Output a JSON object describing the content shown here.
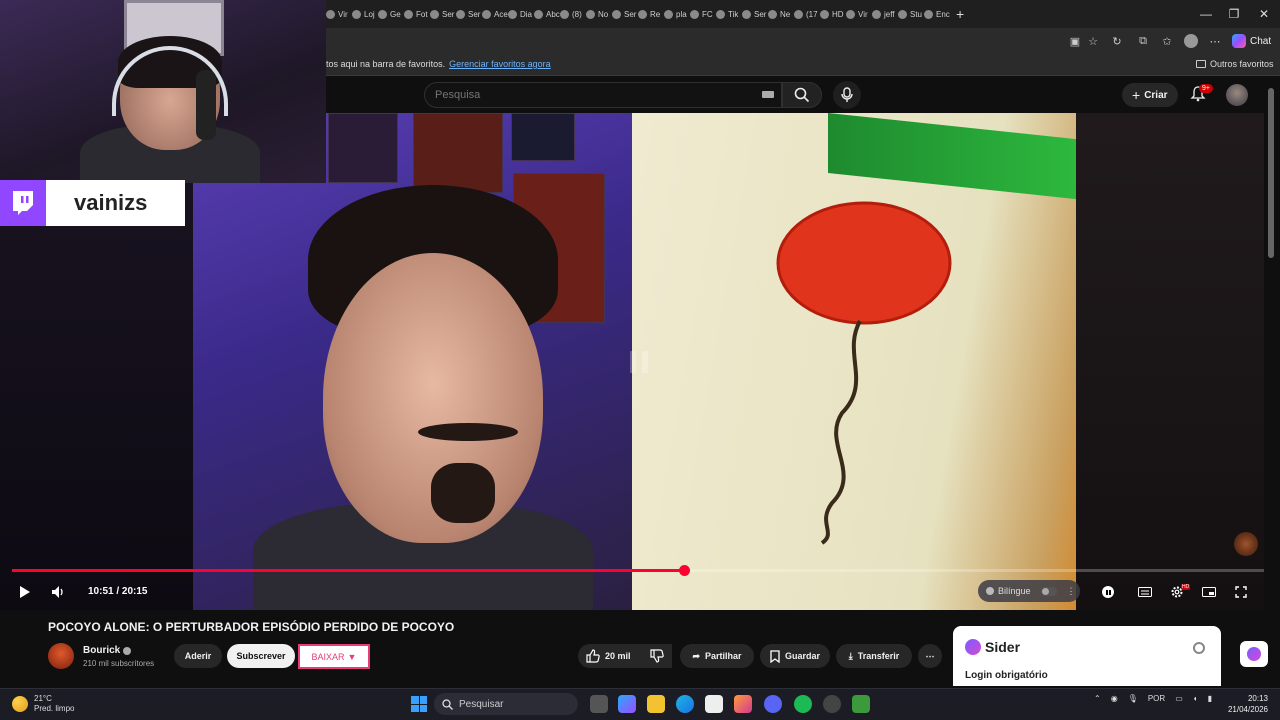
{
  "browser": {
    "tabs": [
      "Vir",
      "Loj",
      "Ge",
      "Fot",
      "Ser",
      "Ser",
      "Ace",
      "Dia",
      "Abc",
      "(8)",
      "No",
      "Ser",
      "Re",
      "pla",
      "FC",
      "Tik",
      "Ser",
      "Ne",
      "(17",
      "HD",
      "Vir",
      "jeff",
      "Stu",
      "Enc"
    ],
    "new_tab": "+",
    "chat_label": "Chat",
    "bookmarks_text": "tos aqui na barra de favoritos.",
    "bookmarks_link": "Gerenciar favoritos agora",
    "other_favorites": "Outros favoritos"
  },
  "youtube_header": {
    "search_placeholder": "Pesquisa",
    "create_label": "Criar",
    "notifications_badge": "9+"
  },
  "webcam": {
    "streamer_name": "vainizs"
  },
  "player": {
    "time": "10:51 / 20:15",
    "progress": 0.537,
    "bilingue_label": "Bilíngue",
    "hd_badge": "HD"
  },
  "video": {
    "title": "POCOYO ALONE: O PERTURBADOR EPISÓDIO PERDIDO DE POCOYO",
    "channel_name": "Bourick",
    "subscribers": "210 mil subscritores",
    "join_label": "Aderir",
    "subscribe_label": "Subscrever",
    "baixar_label": "BAIXAR",
    "like_count": "20 mil",
    "share_label": "Partilhar",
    "save_label": "Guardar",
    "download_label": "Transferir"
  },
  "sider": {
    "title": "Sider",
    "login_text": "Login obrigatório"
  },
  "taskbar": {
    "temperature": "21°C",
    "weather_desc": "Pred. limpo",
    "search_label": "Pesquisar",
    "lang": "POR",
    "time": "20:13",
    "date": "21/04/2026"
  },
  "colors": {
    "youtube_red": "#ff0033",
    "twitch_purple": "#9146ff",
    "baixar_pink": "#e63d7a"
  }
}
